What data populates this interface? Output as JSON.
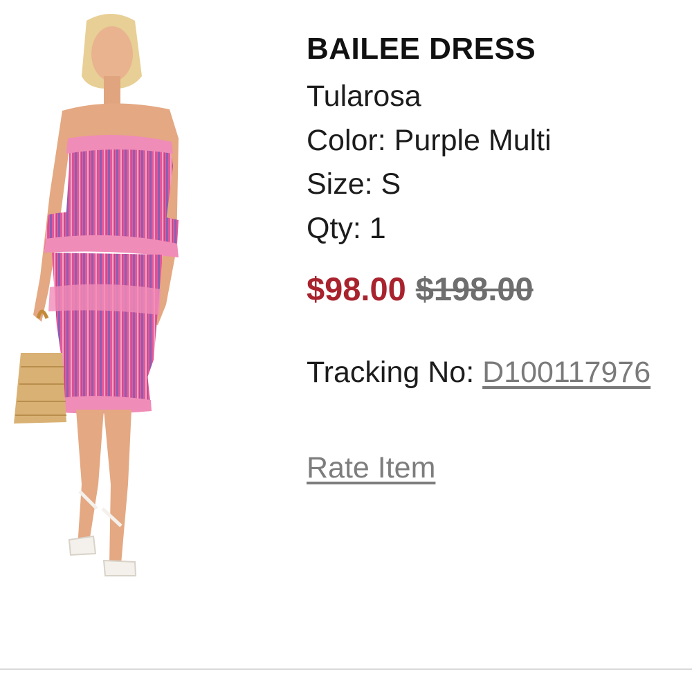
{
  "product": {
    "name": "BAILEE DRESS",
    "brand": "Tularosa",
    "color": "Color: Purple Multi",
    "size": "Size: S",
    "qty": "Qty: 1",
    "sale_price": "$98.00",
    "original_price": "$198.00",
    "tracking_label": "Tracking No:",
    "tracking_number": "D100117976",
    "rate_label": "Rate Item"
  },
  "colors": {
    "sale_price": "#a8232e",
    "original_price": "#6e6e6e",
    "link": "#7d7d7d",
    "dress_pink": "#e0508a",
    "dress_purple": "#8a5fb0"
  }
}
